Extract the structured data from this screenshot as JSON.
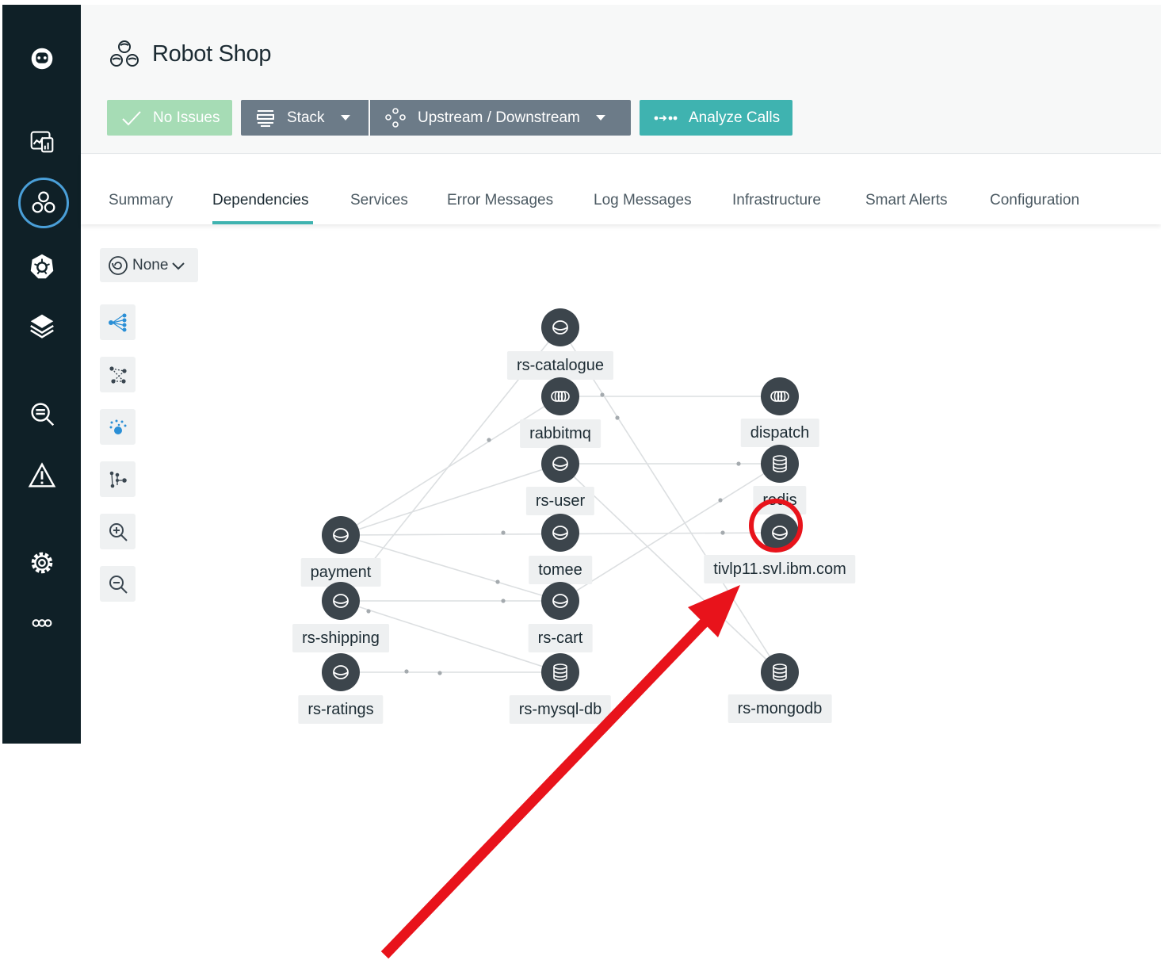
{
  "sidebar": {
    "items": [
      {
        "icon": "instana-logo-icon"
      },
      {
        "icon": "websites-dashboard-icon"
      },
      {
        "icon": "applications-icon",
        "active": true
      },
      {
        "icon": "kubernetes-icon"
      },
      {
        "icon": "stack-layers-icon"
      },
      {
        "icon": "analytics-search-icon"
      },
      {
        "icon": "events-warning-icon"
      },
      {
        "icon": "settings-gear-icon"
      },
      {
        "icon": "more-dots-icon"
      }
    ]
  },
  "header": {
    "title": "Robot Shop",
    "buttons": {
      "no_issues": "No Issues",
      "stack": "Stack",
      "upstream_downstream": "Upstream / Downstream",
      "analyze_calls": "Analyze Calls"
    }
  },
  "tabs": [
    "Summary",
    "Dependencies",
    "Services",
    "Error Messages",
    "Log Messages",
    "Infrastructure",
    "Smart Alerts",
    "Configuration"
  ],
  "active_tab": "Dependencies",
  "toolbar": {
    "filter_label": "None",
    "tools": [
      "layout-tree-icon",
      "layout-force-icon",
      "layout-cluster-icon",
      "layout-flow-icon",
      "zoom-in-icon",
      "zoom-out-icon"
    ]
  },
  "graph": {
    "nodes": {
      "rs_catalogue": {
        "label": "rs-catalogue",
        "icon": "database-icon"
      },
      "rabbitmq": {
        "label": "rabbitmq",
        "icon": "queue-icon"
      },
      "dispatch": {
        "label": "dispatch",
        "icon": "queue-icon"
      },
      "rs_user": {
        "label": "rs-user",
        "icon": "database-icon"
      },
      "redis": {
        "label": "redis",
        "icon": "database-stack-icon"
      },
      "payment": {
        "label": "payment",
        "icon": "database-icon"
      },
      "tomee": {
        "label": "tomee",
        "icon": "database-icon"
      },
      "tivlp11": {
        "label": "tivlp11.svl.ibm.com",
        "icon": "database-icon"
      },
      "rs_shipping": {
        "label": "rs-shipping",
        "icon": "database-icon"
      },
      "rs_cart": {
        "label": "rs-cart",
        "icon": "database-icon"
      },
      "rs_ratings": {
        "label": "rs-ratings",
        "icon": "database-icon"
      },
      "rs_mysql_db": {
        "label": "rs-mysql-db",
        "icon": "database-stack-icon"
      },
      "rs_mongodb": {
        "label": "rs-mongodb",
        "icon": "database-stack-icon"
      }
    }
  },
  "annotation": {
    "color": "#e8131b"
  }
}
